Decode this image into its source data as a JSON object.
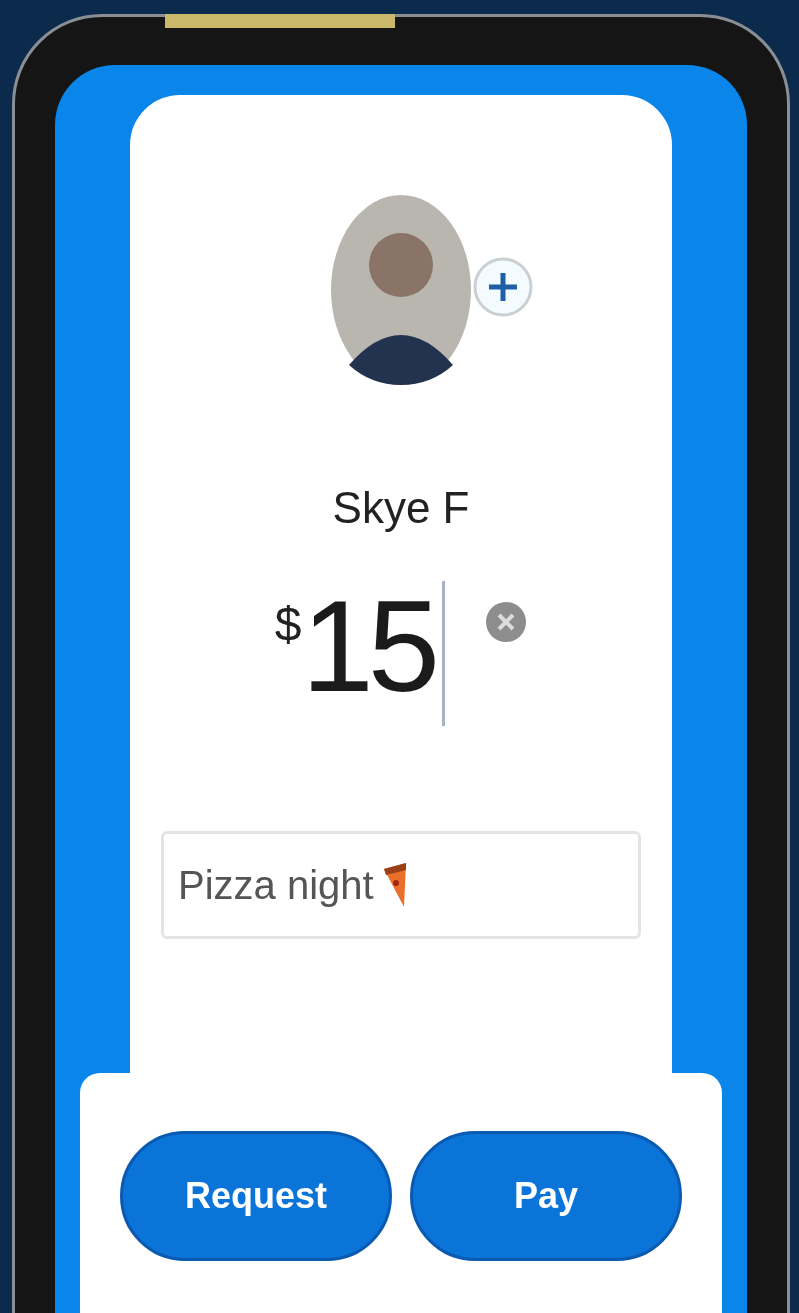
{
  "contact": {
    "name": "Skye F"
  },
  "amount": {
    "currency": "$",
    "value": "15"
  },
  "note": {
    "value": "Pizza night"
  },
  "actions": [
    {
      "label": "Request"
    },
    {
      "label": "Pay"
    }
  ]
}
